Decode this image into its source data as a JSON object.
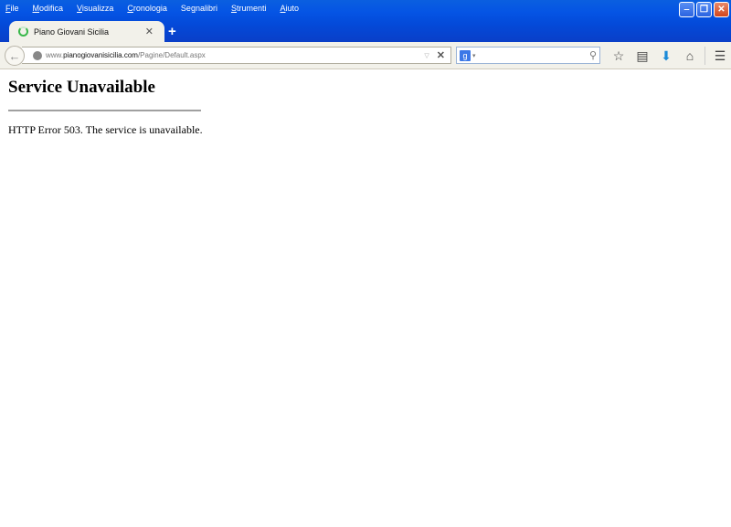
{
  "menu": {
    "items": [
      {
        "mnemonic": "F",
        "rest": "ile"
      },
      {
        "mnemonic": "M",
        "rest": "odifica"
      },
      {
        "mnemonic": "V",
        "rest": "isualizza"
      },
      {
        "mnemonic": "C",
        "rest": "ronologia"
      },
      {
        "mnemonic": "S",
        "rest": "egnalibri"
      },
      {
        "mnemonic": "S",
        "rest": "trumenti"
      },
      {
        "mnemonic": "A",
        "rest": "iuto"
      }
    ]
  },
  "window_controls": {
    "minimize": "‒",
    "restore": "❐",
    "close": "✕"
  },
  "tab": {
    "title": "Piano Giovani Sicilia",
    "close_glyph": "✕",
    "new_tab_glyph": "+"
  },
  "navbar": {
    "back_glyph": "←",
    "url_prefix": "www.",
    "url_domain": "pianogiovanisicilia.com",
    "url_path": "/Pagine/Default.aspx",
    "url_dropdown_glyph": "▽",
    "stop_glyph": "✕",
    "search_engine_glyph": "g",
    "search_caret": "▾",
    "search_placeholder": "",
    "search_icon_glyph": "⚲"
  },
  "toolbar": {
    "bookmark_glyph": "☆",
    "reading_list_glyph": "▤",
    "download_glyph": "⬇",
    "home_glyph": "⌂",
    "menu_glyph": "☰"
  },
  "page": {
    "heading": "Service Unavailable",
    "message": "HTTP Error 503. The service is unavailable."
  }
}
